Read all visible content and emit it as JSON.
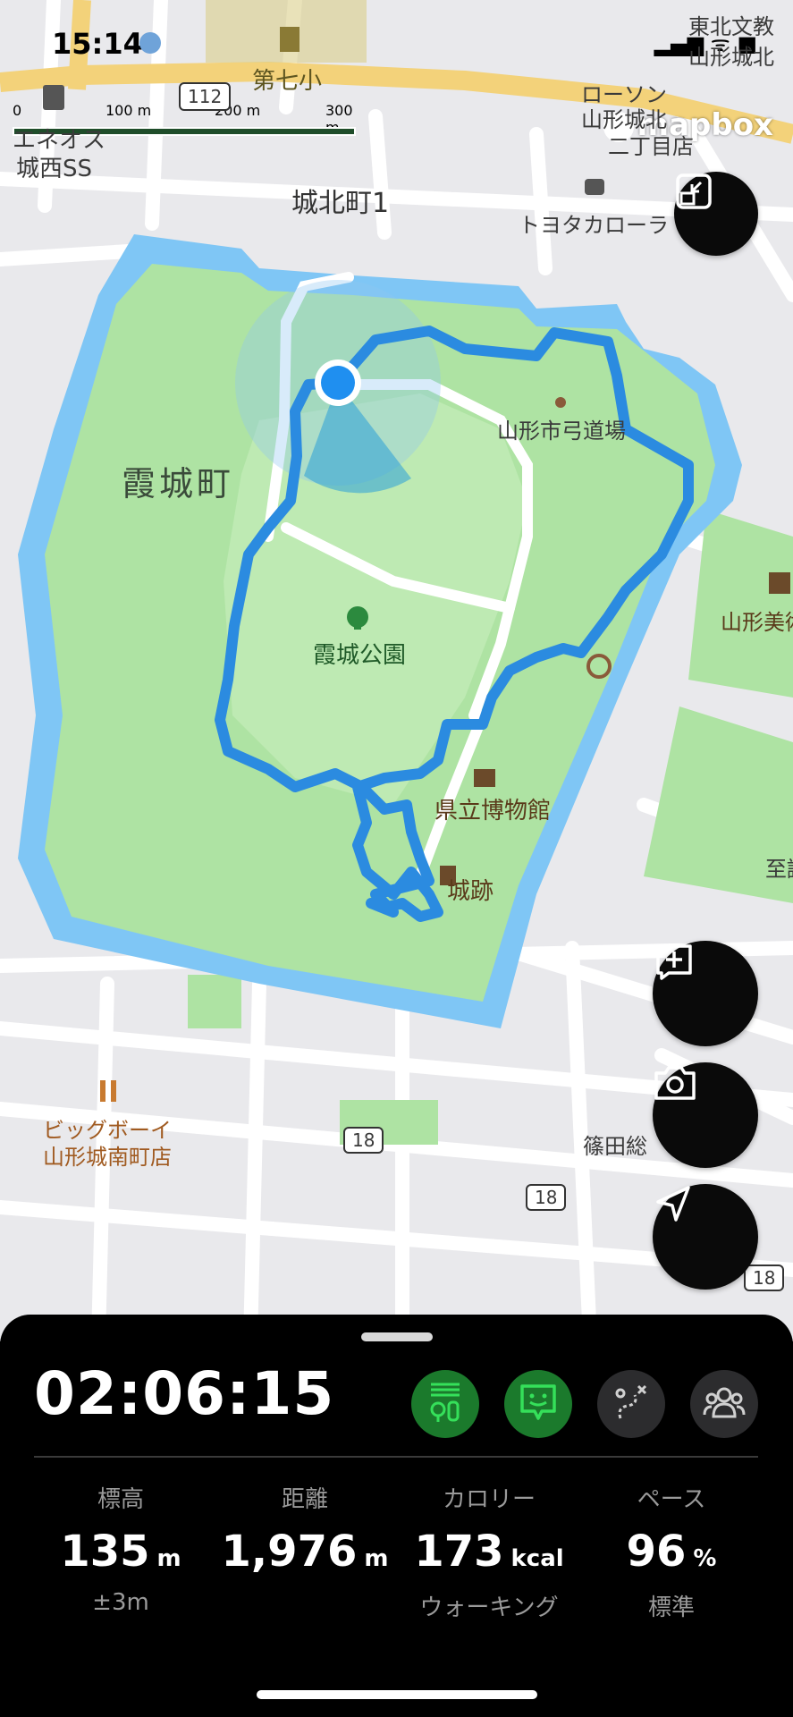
{
  "status_bar": {
    "time": "15:14",
    "indicators": "▂▄▆ ᯤ ■"
  },
  "map": {
    "labels": {
      "school": "第七小",
      "route112": "112",
      "ss1": "エネオス",
      "ss2": "城西SS",
      "area_north": "城北町1",
      "lawson1": "ローソン",
      "lawson2": "山形城北",
      "lawson3": "二丁目店",
      "toyota": "トヨタカローラ",
      "tohoku1": "東北文教",
      "tohoku2": "山形城北",
      "kasumi": "霞城町",
      "kyudo": "山形市弓道場",
      "park": "霞城公園",
      "museum_art": "山形美術",
      "museum": "県立博物館",
      "castle": "城跡",
      "restaurant1": "ビッグボーイ",
      "restaurant2": "山形城南町店",
      "route18a": "18",
      "route18b": "18",
      "route18c": "18",
      "shinoda": "篠田総",
      "right_edge": "至誠"
    },
    "scale": {
      "t0": "0",
      "t1": "100 m",
      "t2": "200 m",
      "t3": "300 m"
    },
    "attribution": "mapbox"
  },
  "controls": {
    "collapse_icon": "collapse-map-icon",
    "add_note_icon": "add-note-icon",
    "camera_icon": "camera-icon",
    "locate_icon": "locate-arrow-icon"
  },
  "panel": {
    "timer": "02:06:15",
    "buttons": [
      {
        "icon": "route-markers-icon",
        "active": true
      },
      {
        "icon": "face-chat-icon",
        "active": true
      },
      {
        "icon": "route-path-icon",
        "active": false
      },
      {
        "icon": "group-icon",
        "active": false
      }
    ],
    "stats": [
      {
        "label": "標高",
        "value": "135",
        "unit": "m",
        "sub": "±3m"
      },
      {
        "label": "距離",
        "value": "1,976",
        "unit": "m",
        "sub": ""
      },
      {
        "label": "カロリー",
        "value": "173",
        "unit": "kcal",
        "sub": "ウォーキング"
      },
      {
        "label": "ペース",
        "value": "96",
        "unit": "%",
        "sub": "標準"
      }
    ],
    "active_color": "#1b7a2c",
    "active_icon_color": "#35e05a"
  },
  "colors": {
    "track": "#2b8be0",
    "park": "#aee3a3",
    "moat": "#7fc6f5",
    "road_yellow": "#f3d27a"
  }
}
